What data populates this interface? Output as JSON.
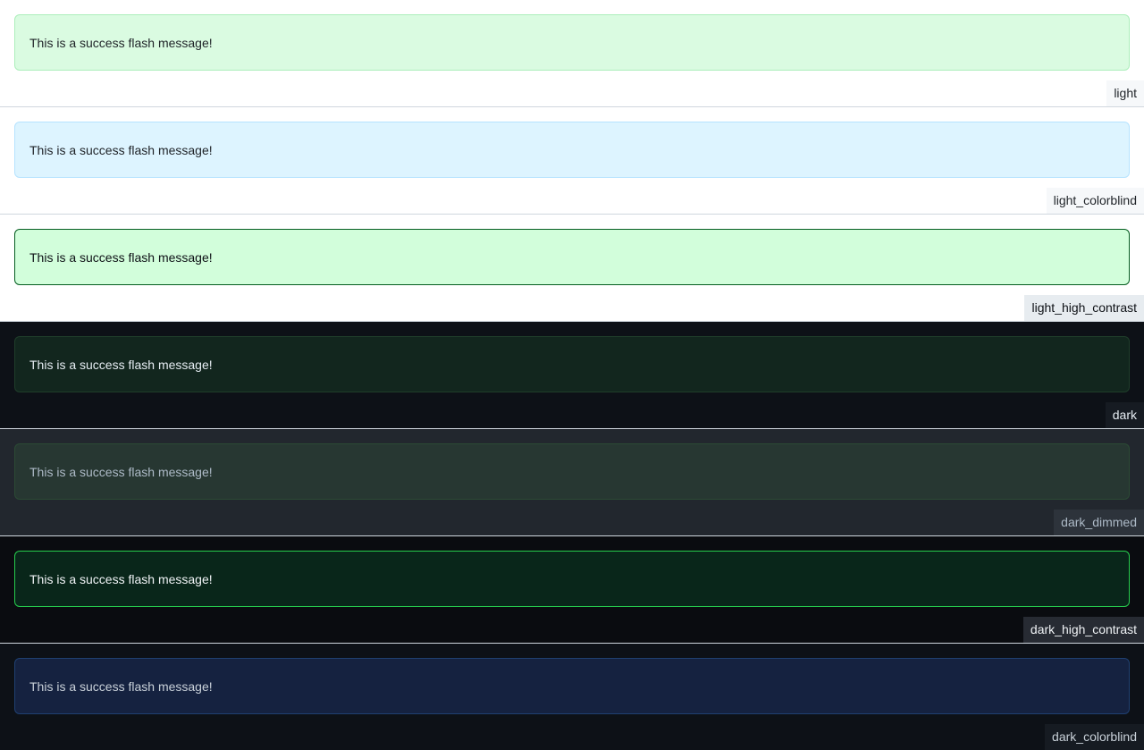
{
  "flash_message": "This is a success flash message!",
  "themes": [
    {
      "name": "light",
      "label": "light"
    },
    {
      "name": "light_colorblind",
      "label": "light_colorblind"
    },
    {
      "name": "light_high_contrast",
      "label": "light_high_contrast"
    },
    {
      "name": "dark",
      "label": "dark"
    },
    {
      "name": "dark_dimmed",
      "label": "dark_dimmed"
    },
    {
      "name": "dark_high_contrast",
      "label": "dark_high_contrast"
    },
    {
      "name": "dark_colorblind",
      "label": "dark_colorblind"
    }
  ],
  "colors": {
    "light_flash_bg": "#dafbe1",
    "light_colorblind_flash_bg": "#ddf4ff",
    "light_high_contrast_flash_bg": "#d2fedb",
    "dark_flash_bg": "#12261e",
    "dark_dimmed_flash_bg": "#273732",
    "dark_high_contrast_flash_bg": "#09261a",
    "dark_colorblind_flash_bg": "#152240"
  }
}
